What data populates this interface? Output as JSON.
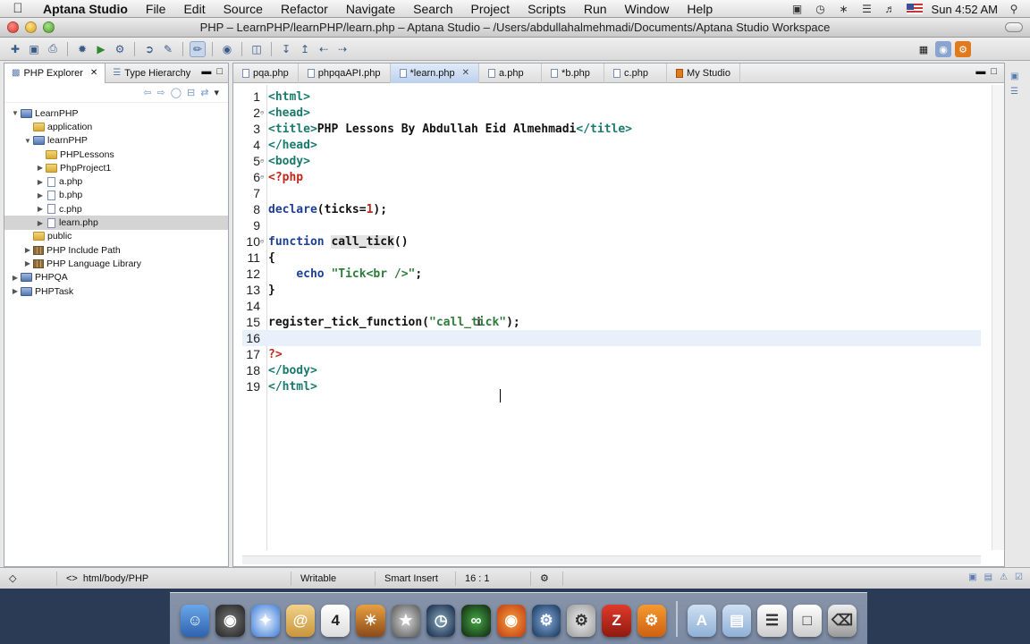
{
  "menubar": {
    "app_name": "Aptana Studio",
    "items": [
      "File",
      "Edit",
      "Source",
      "Refactor",
      "Navigate",
      "Search",
      "Project",
      "Scripts",
      "Run",
      "Window",
      "Help"
    ],
    "clock": "Sun 4:52 AM"
  },
  "window": {
    "title": "PHP – LearnPHP/learnPHP/learn.php – Aptana Studio – /Users/abdullahalmehmadi/Documents/Aptana Studio Workspace"
  },
  "left_panel": {
    "tabs": [
      {
        "label": "PHP Explorer",
        "active": true
      },
      {
        "label": "Type Hierarchy",
        "active": false
      }
    ],
    "tree": [
      {
        "label": "LearnPHP",
        "depth": 0,
        "expanded": true,
        "kind": "project"
      },
      {
        "label": "application",
        "depth": 1,
        "expanded": null,
        "kind": "folder"
      },
      {
        "label": "learnPHP",
        "depth": 1,
        "expanded": true,
        "kind": "project"
      },
      {
        "label": "PHPLessons",
        "depth": 2,
        "expanded": null,
        "kind": "folder"
      },
      {
        "label": "PhpProject1",
        "depth": 2,
        "expanded": false,
        "kind": "folder"
      },
      {
        "label": "a.php",
        "depth": 2,
        "expanded": false,
        "kind": "file"
      },
      {
        "label": "b.php",
        "depth": 2,
        "expanded": false,
        "kind": "file"
      },
      {
        "label": "c.php",
        "depth": 2,
        "expanded": false,
        "kind": "file"
      },
      {
        "label": "learn.php",
        "depth": 2,
        "expanded": false,
        "kind": "file",
        "selected": true
      },
      {
        "label": "public",
        "depth": 1,
        "expanded": null,
        "kind": "folder"
      },
      {
        "label": "PHP Include Path",
        "depth": 1,
        "expanded": false,
        "kind": "lib"
      },
      {
        "label": "PHP Language Library",
        "depth": 1,
        "expanded": false,
        "kind": "lib"
      },
      {
        "label": "PHPQA",
        "depth": 0,
        "expanded": false,
        "kind": "project"
      },
      {
        "label": "PHPTask",
        "depth": 0,
        "expanded": false,
        "kind": "project"
      }
    ]
  },
  "editor": {
    "tabs": [
      {
        "label": "pqa.php",
        "active": false
      },
      {
        "label": "phpqaAPI.php",
        "active": false
      },
      {
        "label": "*learn.php",
        "active": true
      },
      {
        "label": "a.php",
        "active": false
      },
      {
        "label": "*b.php",
        "active": false
      },
      {
        "label": "c.php",
        "active": false
      },
      {
        "label": "My Studio",
        "active": false
      }
    ],
    "lines": [
      {
        "n": "1",
        "tokens": [
          [
            "tag",
            "<html>"
          ]
        ]
      },
      {
        "n": "2",
        "tokens": [
          [
            "tag",
            "<head>"
          ]
        ]
      },
      {
        "n": "3",
        "tokens": [
          [
            "tag",
            "<title>"
          ],
          [
            "txt",
            "PHP Lessons By Abdullah Eid Almehmadi"
          ],
          [
            "tag",
            "</title>"
          ]
        ]
      },
      {
        "n": "4",
        "tokens": [
          [
            "tag",
            "</head>"
          ]
        ]
      },
      {
        "n": "5",
        "tokens": [
          [
            "tag",
            "<body>"
          ]
        ]
      },
      {
        "n": "6",
        "tokens": [
          [
            "php",
            "<?php"
          ]
        ]
      },
      {
        "n": "7",
        "tokens": []
      },
      {
        "n": "8",
        "tokens": [
          [
            "kw",
            "declare"
          ],
          [
            "plain",
            "(ticks="
          ],
          [
            "num",
            "1"
          ],
          [
            "plain",
            ");"
          ]
        ]
      },
      {
        "n": "9",
        "tokens": []
      },
      {
        "n": "10",
        "tokens": [
          [
            "kw",
            "function"
          ],
          [
            "plain",
            " "
          ],
          [
            "func",
            "call_tick"
          ],
          [
            "plain",
            "()"
          ]
        ]
      },
      {
        "n": "11",
        "tokens": [
          [
            "plain",
            "{"
          ]
        ]
      },
      {
        "n": "12",
        "tokens": [
          [
            "plain",
            "    "
          ],
          [
            "kw",
            "echo"
          ],
          [
            "plain",
            " "
          ],
          [
            "str",
            "\"Tick<br />\""
          ],
          [
            "plain",
            ";"
          ]
        ]
      },
      {
        "n": "13",
        "tokens": [
          [
            "plain",
            "}"
          ]
        ]
      },
      {
        "n": "14",
        "tokens": []
      },
      {
        "n": "15",
        "tokens": [
          [
            "plain",
            "register_tick_function("
          ],
          [
            "str",
            "\"call_tick\""
          ],
          [
            "plain",
            ");"
          ]
        ]
      },
      {
        "n": "16",
        "tokens": [],
        "current": true
      },
      {
        "n": "17",
        "tokens": [
          [
            "php",
            "?>"
          ]
        ]
      },
      {
        "n": "18",
        "tokens": [
          [
            "tag",
            "</body>"
          ]
        ]
      },
      {
        "n": "19",
        "tokens": [
          [
            "tag",
            "</html>"
          ]
        ]
      }
    ]
  },
  "statusbar": {
    "breadcrumb": "html/body/PHP",
    "writable": "Writable",
    "insert_mode": "Smart Insert",
    "position": "16 : 1"
  }
}
